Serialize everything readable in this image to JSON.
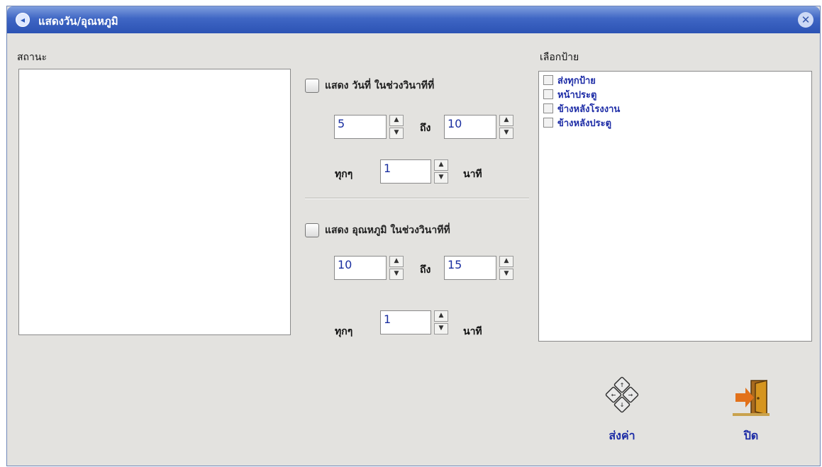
{
  "window": {
    "title": "แสดงวัน/อุณหภูมิ"
  },
  "status": {
    "label": "สถานะ"
  },
  "date_section": {
    "checkbox_label": "แสดง วันที่ ในช่วงวินาทีที่",
    "from_value": "5",
    "to_label": "ถึง",
    "to_value": "10",
    "every_label": "ทุกๆ",
    "every_value": "1",
    "unit_label": "นาที"
  },
  "temp_section": {
    "checkbox_label": "แสดง อุณหภูมิ ในช่วงวินาทีที่",
    "from_value": "10",
    "to_label": "ถึง",
    "to_value": "15",
    "every_label": "ทุกๆ",
    "every_value": "1",
    "unit_label": "นาที"
  },
  "signs": {
    "label": "เลือกป้าย",
    "items": [
      "ส่งทุกป้าย",
      "หน้าประตู",
      "ข้างหลังโรงงาน",
      "ข้างหลังประตู"
    ]
  },
  "actions": {
    "send_label": "ส่งค่า",
    "close_label": "ปิด"
  },
  "icons": {
    "title": "app-icon",
    "close": "close-icon",
    "send": "keys-icon",
    "exit": "exit-door-icon"
  },
  "colors": {
    "titlebar": "#2c53b4",
    "accent_text": "#1d2ca6",
    "panel": "#e3e2df"
  }
}
